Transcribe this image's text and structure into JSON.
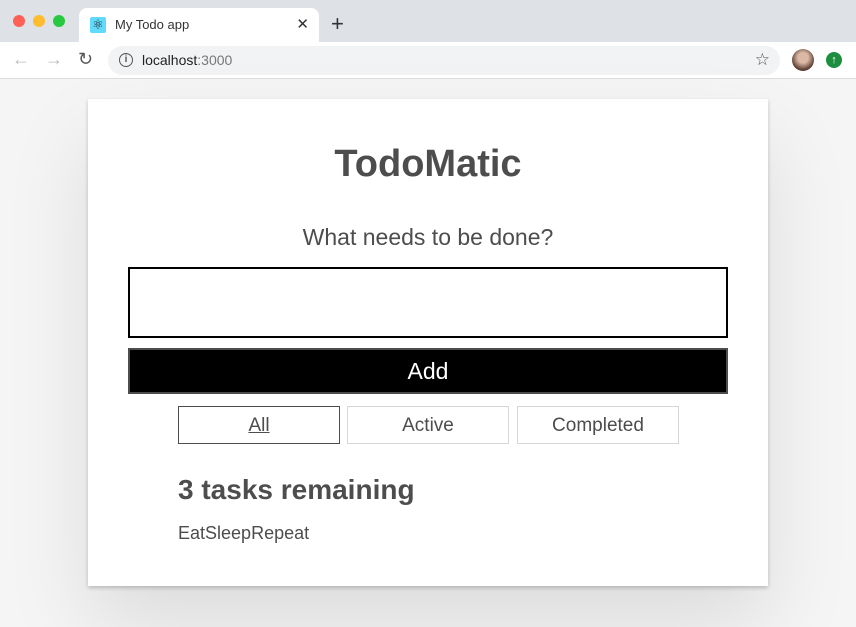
{
  "browser": {
    "tab_title": "My Todo app",
    "url_host": "localhost",
    "url_port": ":3000",
    "tab_icon": "react-icon"
  },
  "app": {
    "title": "TodoMatic",
    "prompt": "What needs to be done?",
    "input_value": "",
    "add_label": "Add",
    "filters": [
      {
        "label": "All",
        "selected": true
      },
      {
        "label": "Active",
        "selected": false
      },
      {
        "label": "Completed",
        "selected": false
      }
    ],
    "remaining": "3 tasks remaining",
    "tasks": [
      "Eat",
      "Sleep",
      "Repeat"
    ]
  }
}
